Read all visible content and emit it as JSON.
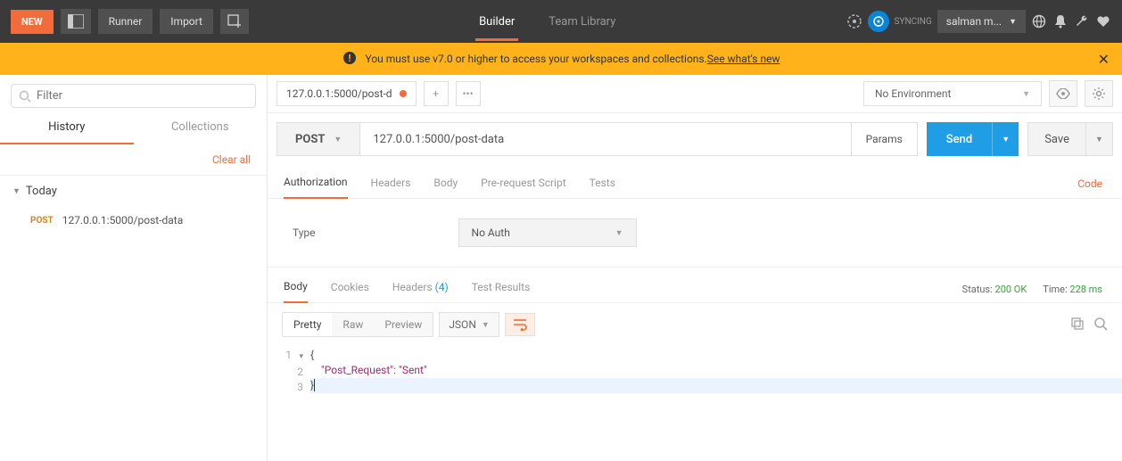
{
  "header": {
    "new_label": "NEW",
    "runner_label": "Runner",
    "import_label": "Import",
    "nav_builder": "Builder",
    "nav_team_library": "Team Library",
    "sync_label": "SYNCING",
    "user_name": "salman m..."
  },
  "warning": {
    "text_pre": "You must use v7.0 or higher to access your workspaces and collections. ",
    "link_text": "See what's new"
  },
  "sidebar": {
    "filter_placeholder": "Filter",
    "tab_history": "History",
    "tab_collections": "Collections",
    "clear_all": "Clear all",
    "day_label": "Today",
    "items": [
      {
        "method": "POST",
        "url": "127.0.0.1:5000/post-data"
      }
    ]
  },
  "tabs": {
    "active_tab_label": "127.0.0.1:5000/post-d"
  },
  "env": {
    "selected": "No Environment"
  },
  "request": {
    "method": "POST",
    "url": "127.0.0.1:5000/post-data",
    "params_label": "Params",
    "send_label": "Send",
    "save_label": "Save",
    "tabs": {
      "authorization": "Authorization",
      "headers": "Headers",
      "body": "Body",
      "prerequest": "Pre-request Script",
      "tests": "Tests"
    },
    "code_link": "Code",
    "auth_type_label": "Type",
    "auth_type_value": "No Auth"
  },
  "response": {
    "tabs": {
      "body": "Body",
      "cookies": "Cookies",
      "headers": "Headers",
      "headers_count": "(4)",
      "test_results": "Test Results"
    },
    "status_label": "Status:",
    "status_value": "200 OK",
    "time_label": "Time:",
    "time_value": "228 ms",
    "view": {
      "pretty": "Pretty",
      "raw": "Raw",
      "preview": "Preview",
      "format": "JSON"
    },
    "body_lines": [
      {
        "n": "1",
        "fold": true,
        "text": "{"
      },
      {
        "n": "2",
        "text_indent": "    ",
        "key": "\"Post_Request\"",
        "sep": ": ",
        "val": "\"Sent\""
      },
      {
        "n": "3",
        "text": "}"
      }
    ]
  }
}
